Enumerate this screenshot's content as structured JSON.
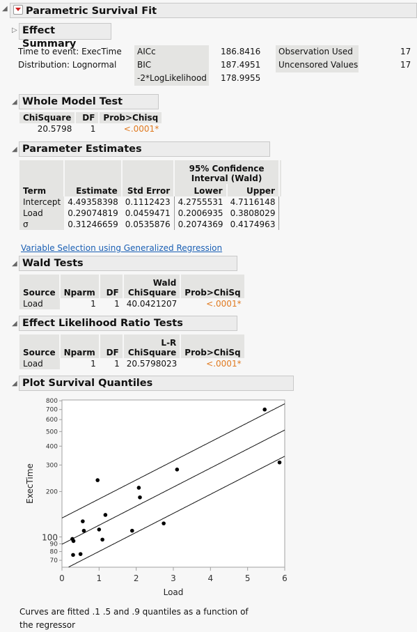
{
  "report": {
    "title": "Parametric Survival Fit",
    "effect_summary": "Effect Summary",
    "time_to_event": "Time to event: ExecTime",
    "distribution": "Distribution: Lognormal",
    "fit_stats": [
      {
        "label": "AICc",
        "value": "186.8416"
      },
      {
        "label": "BIC",
        "value": "187.4951"
      },
      {
        "label": "-2*LogLikelihood",
        "value": "178.9955"
      }
    ],
    "obs_stats": [
      {
        "label": "Observation Used",
        "value": "17"
      },
      {
        "label": "Uncensored Values",
        "value": "17"
      }
    ]
  },
  "whole_model": {
    "title": "Whole Model Test",
    "headers": [
      "ChiSquare",
      "DF",
      "Prob>Chisq"
    ],
    "row": [
      "20.5798",
      "1",
      "<.0001*"
    ]
  },
  "param_est": {
    "title": "Parameter Estimates",
    "ci_header": "95% Confidence Interval (Wald)",
    "headers": [
      "Term",
      "Estimate",
      "Std Error",
      "Lower",
      "Upper"
    ],
    "rows": [
      [
        "Intercept",
        "4.49358398",
        "0.1112423",
        "4.2755531",
        "4.7116148"
      ],
      [
        "Load",
        "0.29074819",
        "0.0459471",
        "0.2006935",
        "0.3808029"
      ],
      [
        "σ",
        "0.31246659",
        "0.0535876",
        "0.2074369",
        "0.4174963"
      ]
    ],
    "link": "Variable Selection using Generalized Regression"
  },
  "wald": {
    "title": "Wald Tests",
    "headers": [
      "Source",
      "Nparm",
      "DF",
      "Wald ChiSquare",
      "Prob>ChiSq"
    ],
    "row": [
      "Load",
      "1",
      "1",
      "40.0421207",
      "<.0001*"
    ]
  },
  "lr": {
    "title": "Effect Likelihood Ratio Tests",
    "headers": [
      "Source",
      "Nparm",
      "DF",
      "L-R ChiSquare",
      "Prob>ChiSq"
    ],
    "row": [
      "Load",
      "1",
      "1",
      "20.5798023",
      "<.0001*"
    ]
  },
  "plot": {
    "title": "Plot Survival Quantiles",
    "caption": "Curves are fitted .1 .5 and .9 quantiles as a function of the regressor"
  },
  "chart_data": {
    "type": "scatter",
    "title": "Plot Survival Quantiles",
    "xlabel": "Load",
    "ylabel": "ExecTime",
    "xlim": [
      0,
      6
    ],
    "ylim": [
      63,
      810
    ],
    "yscale": "log",
    "xticks": [
      0,
      1,
      2,
      3,
      4,
      5,
      6
    ],
    "yticks": [
      70,
      80,
      90,
      100,
      200,
      300,
      400,
      500,
      600,
      700,
      800
    ],
    "grid": false,
    "points": [
      {
        "x": 0.28,
        "y": 97
      },
      {
        "x": 0.31,
        "y": 94
      },
      {
        "x": 0.3,
        "y": 76
      },
      {
        "x": 0.5,
        "y": 77
      },
      {
        "x": 0.56,
        "y": 127
      },
      {
        "x": 0.59,
        "y": 110
      },
      {
        "x": 0.96,
        "y": 238
      },
      {
        "x": 1.0,
        "y": 112
      },
      {
        "x": 1.09,
        "y": 96
      },
      {
        "x": 1.17,
        "y": 140
      },
      {
        "x": 1.89,
        "y": 110
      },
      {
        "x": 2.07,
        "y": 212
      },
      {
        "x": 2.1,
        "y": 183
      },
      {
        "x": 2.74,
        "y": 123
      },
      {
        "x": 3.1,
        "y": 280
      },
      {
        "x": 5.46,
        "y": 700
      },
      {
        "x": 5.86,
        "y": 312
      }
    ],
    "quantile_lines": [
      {
        "name": "0.9 quantile",
        "intercept_log": 4.8941,
        "slope_log": 0.29074819
      },
      {
        "name": "0.5 quantile",
        "intercept_log": 4.49358398,
        "slope_log": 0.29074819
      },
      {
        "name": "0.1 quantile",
        "intercept_log": 4.0931,
        "slope_log": 0.29074819
      }
    ]
  }
}
